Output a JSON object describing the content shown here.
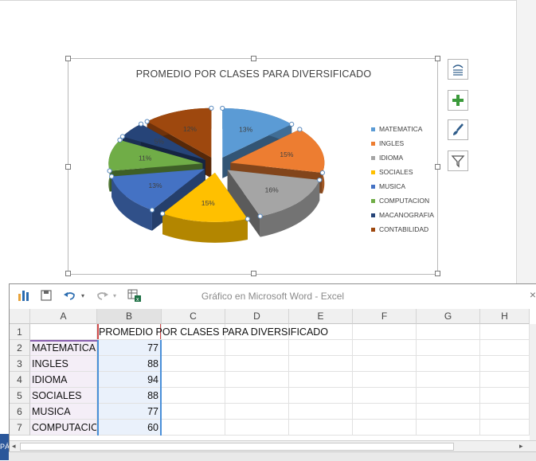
{
  "chart": {
    "title": "PROMEDIO POR CLASES PARA DIVERSIFICADO"
  },
  "chart_data": {
    "type": "pie",
    "title": "PROMEDIO POR CLASES PARA DIVERSIFICADO",
    "categories": [
      "MATEMATICA",
      "INGLES",
      "IDIOMA",
      "SOCIALES",
      "MUSICA",
      "COMPUTACION",
      "MACANOGRAFIA",
      "CONTABILIDAD"
    ],
    "percent_labels": [
      "13%",
      "15%",
      "16%",
      "15%",
      "13%",
      "11%",
      "5%",
      "12%"
    ],
    "values": [
      77,
      88,
      94,
      88,
      77,
      60,
      30,
      70
    ],
    "colors": [
      "#5b9bd5",
      "#ed7d31",
      "#a5a5a5",
      "#ffc000",
      "#4472c4",
      "#70ad47",
      "#264478",
      "#9e480e"
    ],
    "legend_position": "right",
    "exploded": true,
    "style": "3d"
  },
  "chart_tools": [
    "layout-options-icon",
    "chart-elements-icon",
    "chart-styles-icon",
    "chart-filters-icon"
  ],
  "excel": {
    "title": "Gráfico en Microsoft Word - Excel",
    "columns": [
      "A",
      "B",
      "C",
      "D",
      "E",
      "F",
      "G",
      "H"
    ],
    "rows": [
      {
        "n": "1",
        "a": "",
        "b": "PROMEDIO POR CLASES PARA DIVERSIFICADO"
      },
      {
        "n": "2",
        "a": "MATEMATICA",
        "b": "77"
      },
      {
        "n": "3",
        "a": "INGLES",
        "b": "88"
      },
      {
        "n": "4",
        "a": "IDIOMA",
        "b": "94"
      },
      {
        "n": "5",
        "a": "SOCIALES",
        "b": "88"
      },
      {
        "n": "6",
        "a": "MUSICA",
        "b": "77"
      },
      {
        "n": "7",
        "a": "COMPUTACION",
        "b": "60"
      }
    ],
    "close_glyph": "×"
  },
  "statusbar": {
    "left_text": "PÁ"
  }
}
